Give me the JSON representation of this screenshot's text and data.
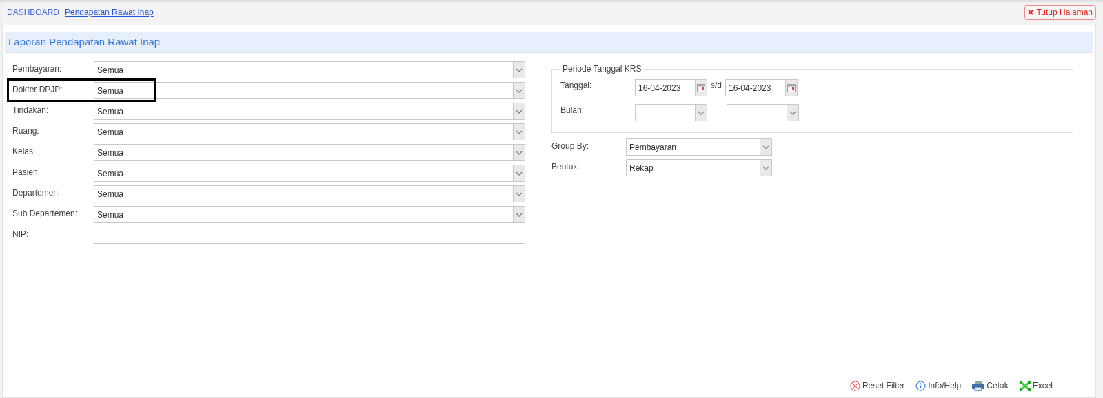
{
  "breadcrumb": [
    {
      "label": "DASHBOARD",
      "current": false
    },
    {
      "label": "Pendapatan Rawat Inap",
      "current": true
    }
  ],
  "close_button": {
    "label": "Tutup Halaman"
  },
  "panel": {
    "title": "Laporan Pendapatan Rawat Inap"
  },
  "left_fields": [
    {
      "label": "Pembayaran:",
      "kind": "select",
      "value": "Semua",
      "highlighted": false
    },
    {
      "label": "Dokter DPJP:",
      "kind": "select",
      "value": "Semua",
      "highlighted": true
    },
    {
      "label": "Tindakan:",
      "kind": "select",
      "value": "Semua",
      "highlighted": false
    },
    {
      "label": "Ruang:",
      "kind": "select",
      "value": "Semua",
      "highlighted": false
    },
    {
      "label": "Kelas:",
      "kind": "select",
      "value": "Semua",
      "highlighted": false
    },
    {
      "label": "Pasien:",
      "kind": "select",
      "value": "Semua",
      "highlighted": false
    },
    {
      "label": "Departemen:",
      "kind": "select",
      "value": "Semua",
      "highlighted": false
    },
    {
      "label": "Sub Departemen:",
      "kind": "select",
      "value": "Semua",
      "highlighted": false
    },
    {
      "label": "NIP:",
      "kind": "text",
      "highlighted": false
    }
  ],
  "period": {
    "legend": "Periode Tanggal KRS",
    "date_label": "Tanggal:",
    "date_from": "16-04-2023",
    "separator": "s/d",
    "date_to": "16-04-2023",
    "month_label": "Bulan:"
  },
  "right_fields": [
    {
      "label": "Group By:",
      "kind": "select",
      "value": "Pembayaran"
    },
    {
      "label": "Bentuk:",
      "kind": "select",
      "value": "Rekap"
    }
  ],
  "actions": [
    {
      "label": "Reset Filter",
      "kind": "reset"
    },
    {
      "label": "Info/Help",
      "kind": "info"
    },
    {
      "label": "Cetak",
      "kind": "print"
    },
    {
      "label": "Excel",
      "kind": "excel"
    }
  ]
}
